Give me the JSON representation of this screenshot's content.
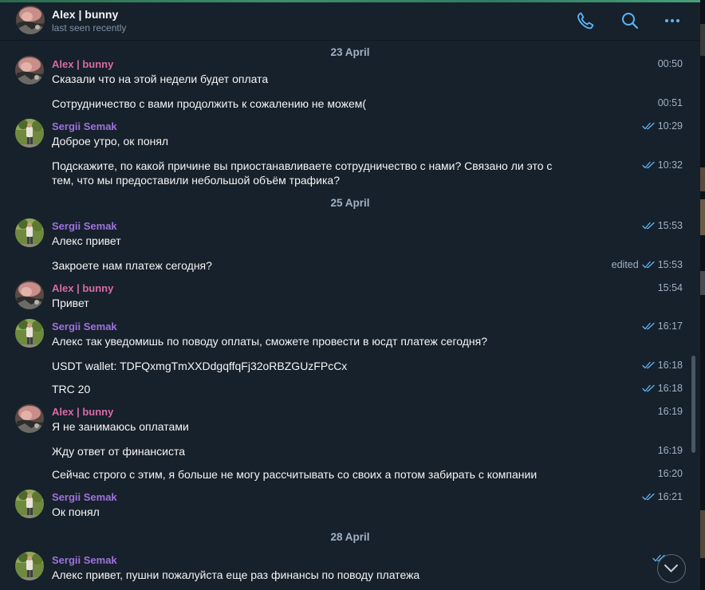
{
  "header": {
    "name": "Alex | bunny",
    "status": "last seen recently"
  },
  "colors": {
    "accent": "#5eb5f7",
    "alex_name": "#d96ba5",
    "sergii_name": "#9e72dd",
    "background": "#17212b"
  },
  "dates": [
    "23 April",
    "25 April",
    "28 April"
  ],
  "messages": [
    {
      "sender": "Alex | bunny",
      "text": "Сказали что на этой недели будет оплата",
      "time": "00:50"
    },
    {
      "text": "Сотрудничество с вами продолжить к сожалению не можем(",
      "time": "00:51"
    },
    {
      "sender": "Sergii Semak",
      "text": "Доброе утро, ок понял",
      "time": "10:29"
    },
    {
      "text": "Подскажите, по какой причине вы приостанавливаете сотрудничество с нами? Связано ли это с тем, что мы предоставили небольшой объём трафика?",
      "time": "10:32"
    },
    {
      "sender": "Sergii Semak",
      "text": "Алекс привет",
      "time": "15:53"
    },
    {
      "text": "Закроете нам платеж сегодня?",
      "time": "15:53",
      "edited": "edited"
    },
    {
      "sender": "Alex | bunny",
      "text": "Привет",
      "time": "15:54"
    },
    {
      "sender": "Sergii Semak",
      "text": "Алекс так уведомишь по поводу оплаты, сможете провести в юсдт платеж сегодня?",
      "time": "16:17"
    },
    {
      "text": "USDT wallet: TDFQxmgTmXXDdgqffqFj32oRBZGUzFPcCx",
      "time": "16:18"
    },
    {
      "text": "TRC 20",
      "time": "16:18"
    },
    {
      "sender": "Alex | bunny",
      "text": "Я не занимаюсь оплатами",
      "time": "16:19"
    },
    {
      "text": "Жду ответ от финансиста",
      "time": "16:19"
    },
    {
      "text": "Сейчас строго с этим, я больше не могу рассчитывать со своих а потом забирать с компании",
      "time": "16:20"
    },
    {
      "sender": "Sergii Semak",
      "text": "Ок понял",
      "time": "16:21"
    },
    {
      "sender": "Sergii Semak",
      "text": "Алекс привет, пушни пожалуйста еще раз финансы по поводу платежа",
      "time": ""
    }
  ],
  "icons": {
    "call": "phone-icon",
    "search": "search-icon",
    "more": "more-icon",
    "scroll": "chevron-down-icon",
    "read": "double-check-icon"
  }
}
